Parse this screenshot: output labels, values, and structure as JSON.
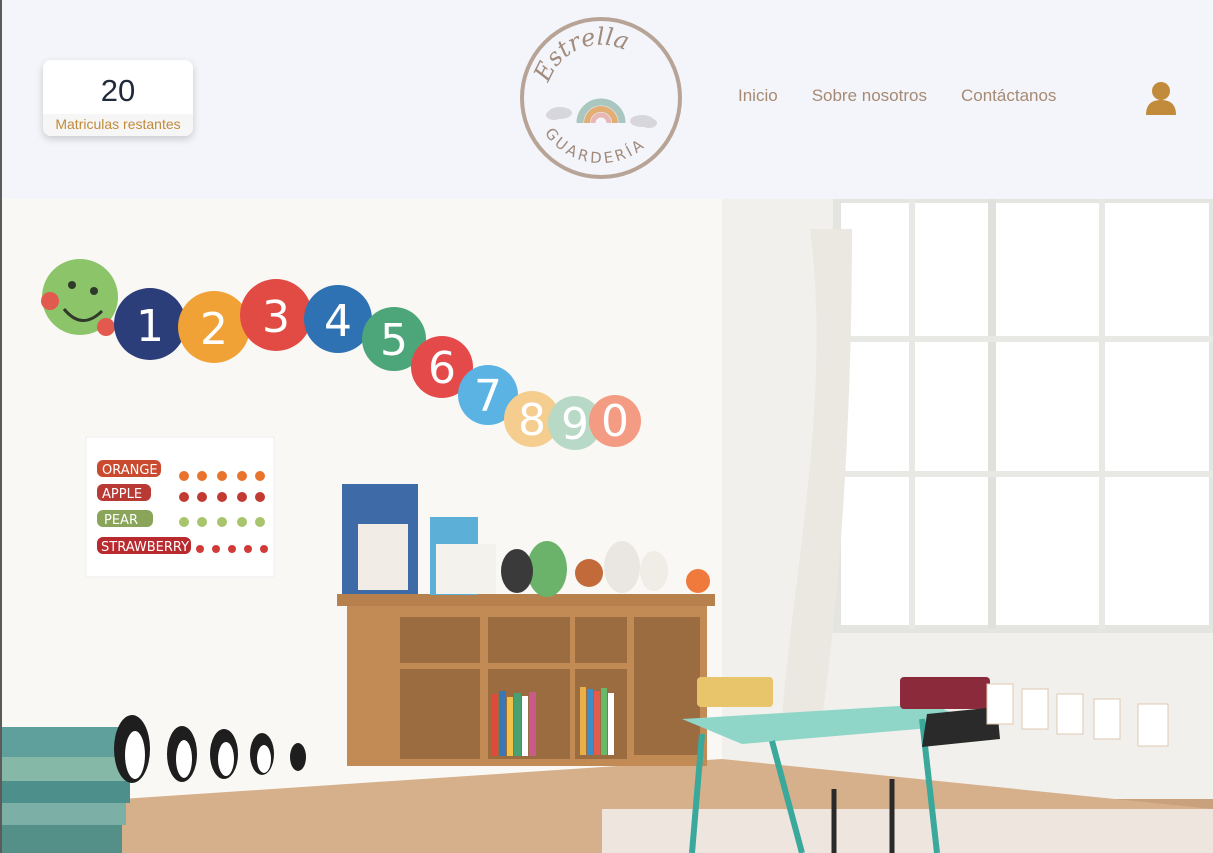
{
  "enrollment": {
    "count": "20",
    "label": "Matriculas restantes"
  },
  "logo": {
    "name": "Estrella",
    "sub": "GUARDERÍA",
    "colors": {
      "ring": "#b8a496",
      "text": "#a18b7c",
      "rainbow_outer": "#a9c7bf",
      "rainbow_mid": "#e2ae74",
      "rainbow_inner": "#e7b7b5"
    }
  },
  "nav": {
    "items": [
      {
        "label": "Inicio"
      },
      {
        "label": "Sobre nosotros"
      },
      {
        "label": "Contáctanos"
      }
    ]
  },
  "icons": {
    "user": "user-icon"
  },
  "colors": {
    "accent": "#c28a3b",
    "nav_text": "#a78a73",
    "header_bg": "#f3f5fa"
  },
  "hero": {
    "caterpillar_numbers": [
      "1",
      "2",
      "3",
      "4",
      "5",
      "6",
      "7",
      "8",
      "9",
      "0"
    ],
    "poster_words": [
      "ORANGE",
      "APPLE",
      "PEAR",
      "STRAWBERRY"
    ]
  }
}
